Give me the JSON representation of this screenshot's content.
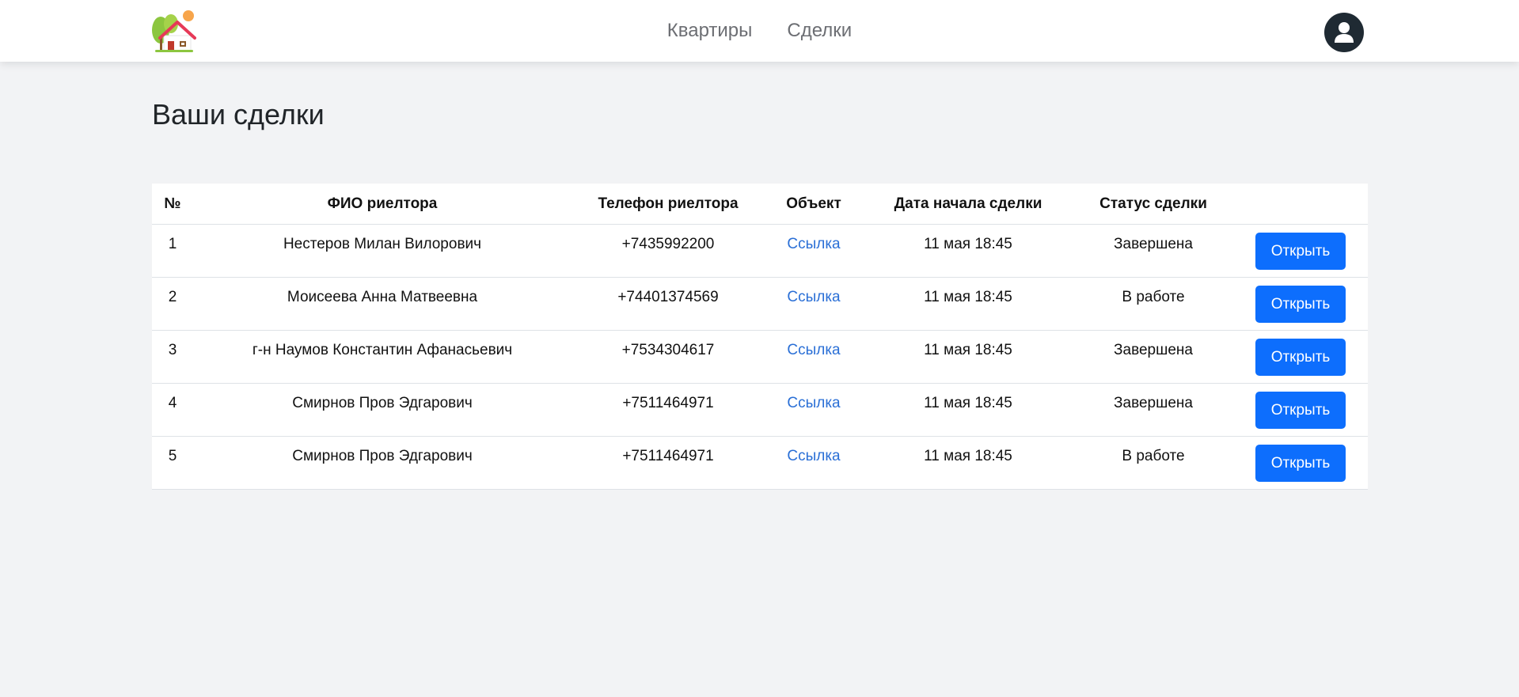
{
  "nav": {
    "links": [
      "Квартиры",
      "Сделки"
    ]
  },
  "page": {
    "title": "Ваши сделки"
  },
  "table": {
    "headers": [
      "№",
      "ФИО риелтора",
      "Телефон риелтора",
      "Объект",
      "Дата начала сделки",
      "Статус сделки",
      ""
    ],
    "rows": [
      {
        "num": "1",
        "name": "Нестеров Милан Вилорович",
        "phone": "+7435992200",
        "object": "Ссылка",
        "date": "11 мая 18:45",
        "status": "Завершена",
        "action": "Открыть"
      },
      {
        "num": "2",
        "name": "Моисеева Анна Матвеевна",
        "phone": "+74401374569",
        "object": "Ссылка",
        "date": "11 мая 18:45",
        "status": "В работе",
        "action": "Открыть"
      },
      {
        "num": "3",
        "name": "г-н Наумов Константин Афанасьевич",
        "phone": "+7534304617",
        "object": "Ссылка",
        "date": "11 мая 18:45",
        "status": "Завершена",
        "action": "Открыть"
      },
      {
        "num": "4",
        "name": "Смирнов Пров Эдгарович",
        "phone": "+7511464971",
        "object": "Ссылка",
        "date": "11 мая 18:45",
        "status": "Завершена",
        "action": "Открыть"
      },
      {
        "num": "5",
        "name": "Смирнов Пров Эдгарович",
        "phone": "+7511464971",
        "object": "Ссылка",
        "date": "11 мая 18:45",
        "status": "В работе",
        "action": "Открыть"
      }
    ]
  },
  "icons": {
    "logo": "house-logo-icon",
    "avatar": "user-icon"
  },
  "colors": {
    "accent": "#0d6efd",
    "link": "#2a6fd6",
    "background": "#f2f3f5",
    "avatar": "#1f2a33"
  }
}
